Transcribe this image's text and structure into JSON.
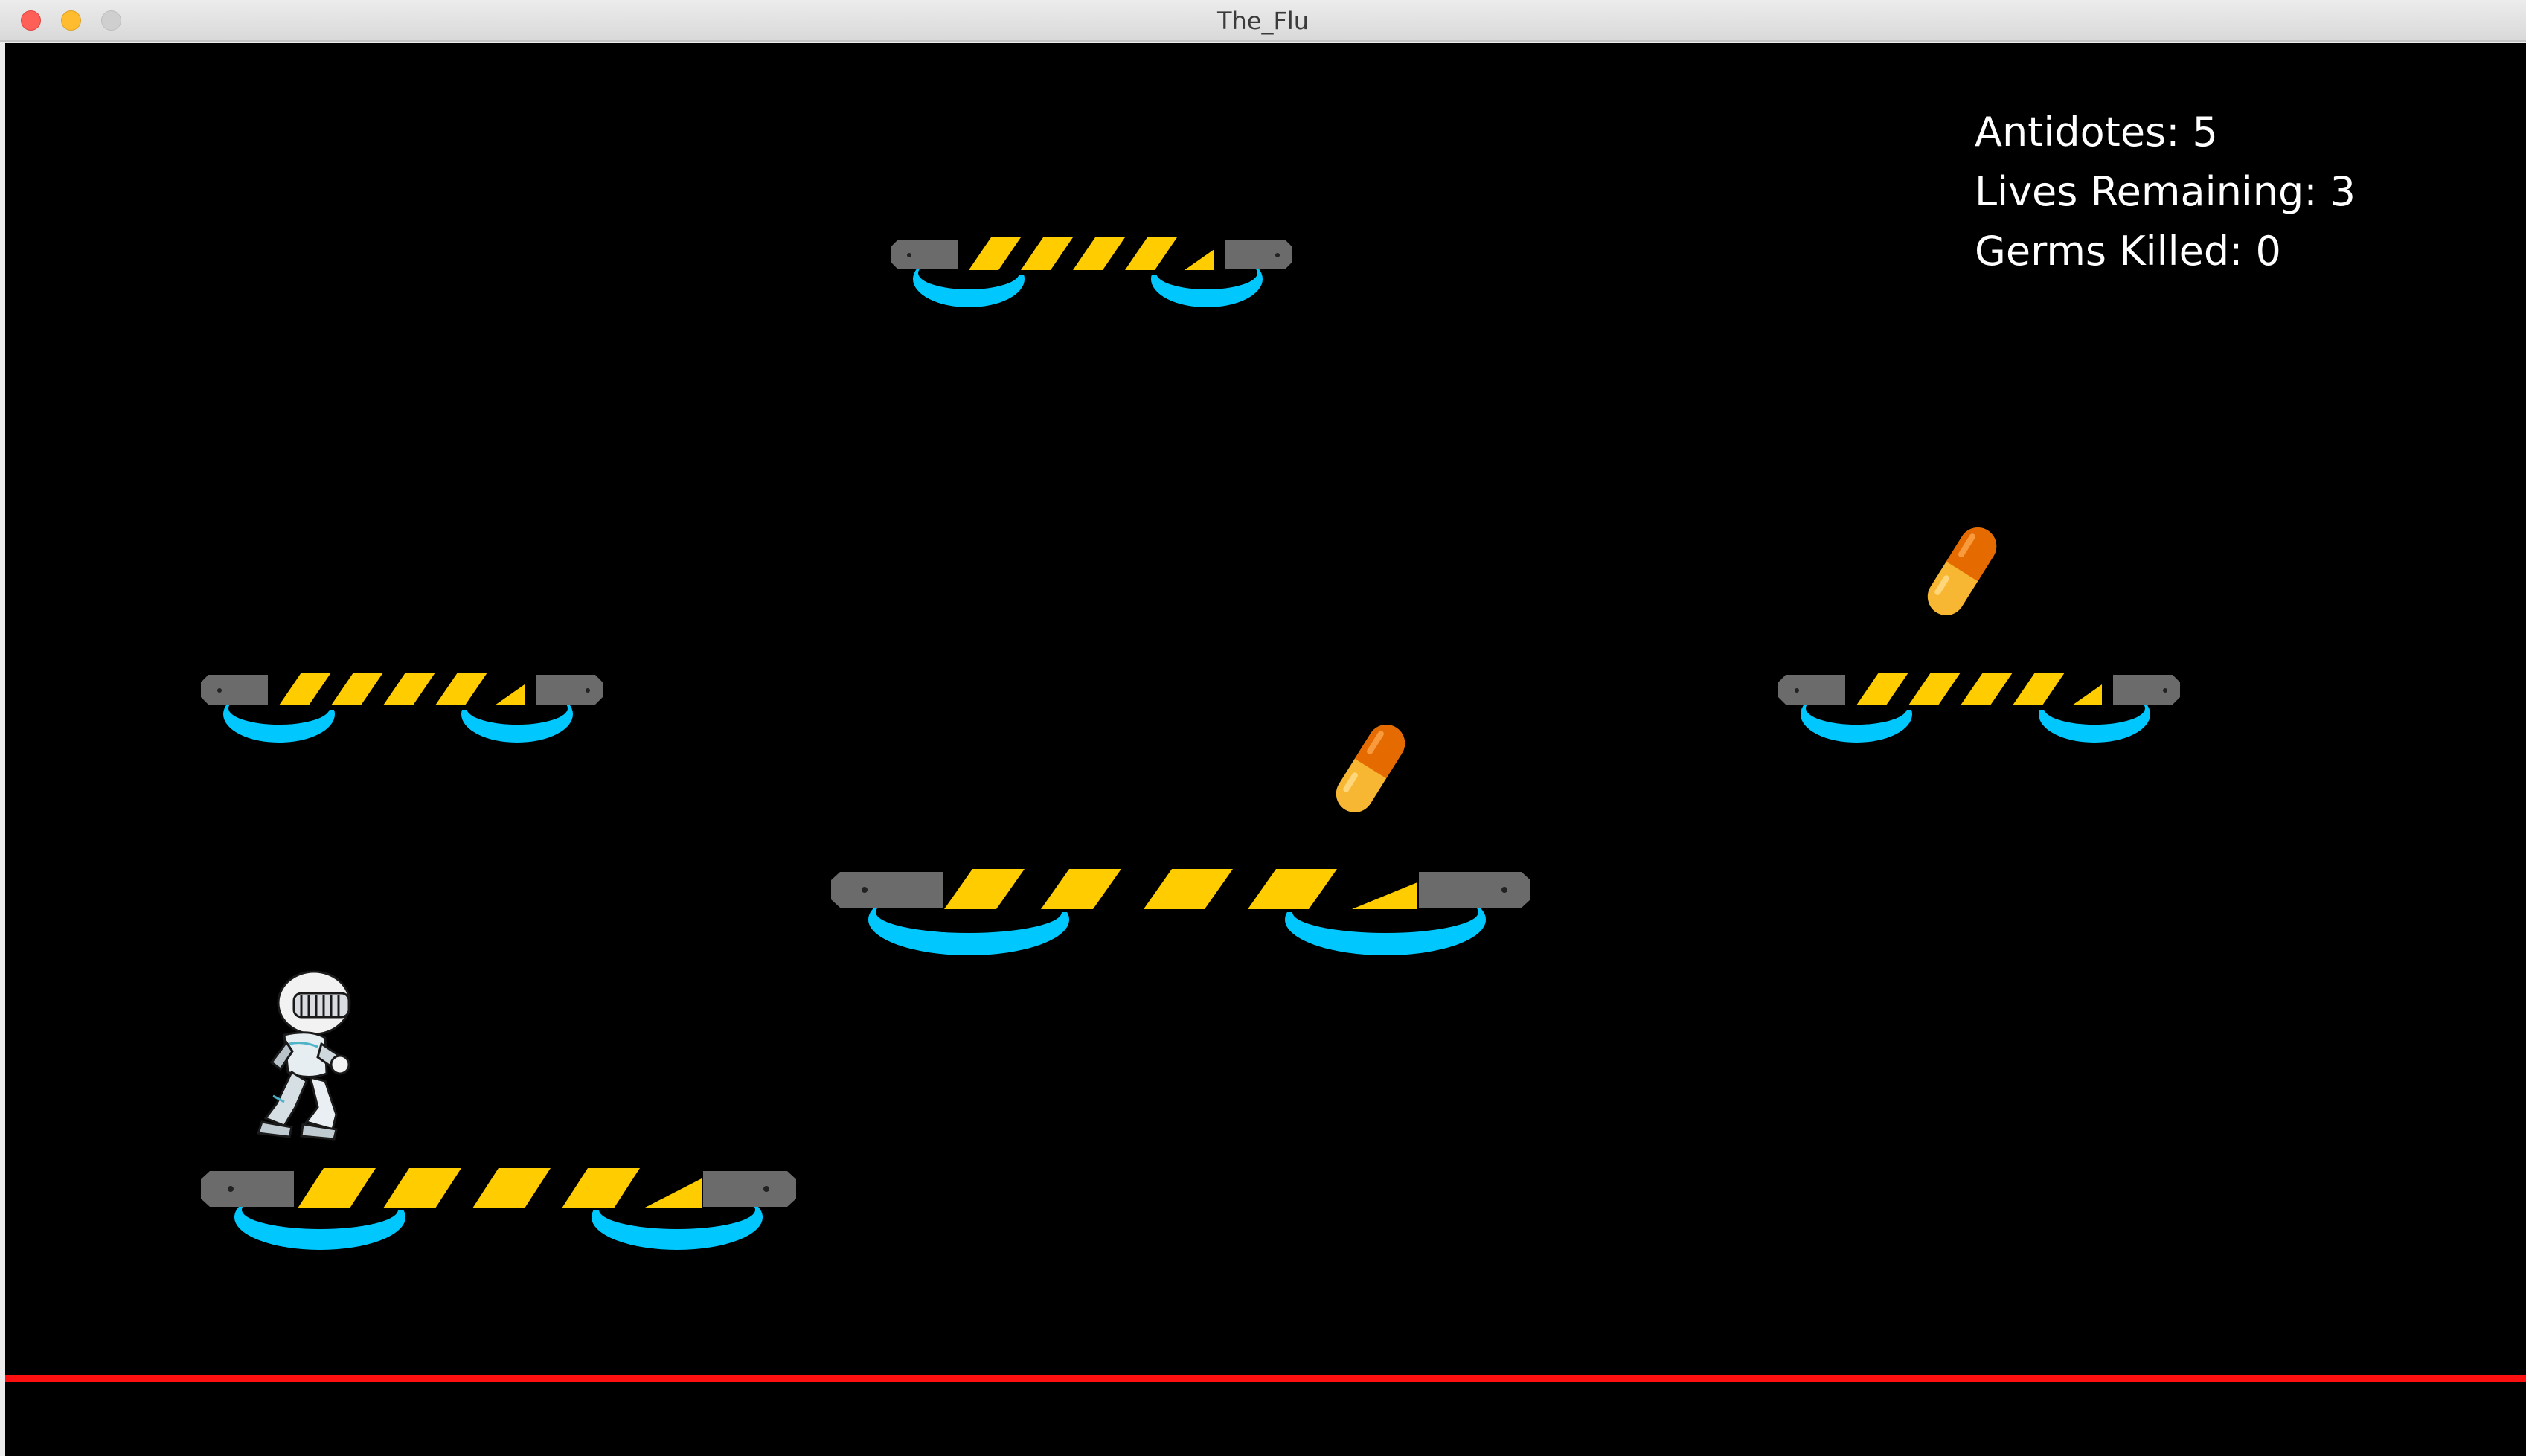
{
  "window": {
    "title": "The_Flu",
    "controls": {
      "close_icon": "close-icon",
      "minimize_icon": "minimize-icon",
      "zoom_icon": "zoom-icon"
    }
  },
  "hud": {
    "antidotes": {
      "label": "Antidotes",
      "value": "5"
    },
    "lives": {
      "label": "Lives Remaining",
      "value": "3"
    },
    "germs": {
      "label": "Germs Killed",
      "value": "0"
    }
  },
  "scene": {
    "platform_icon": "hover-platform",
    "pill_icon": "antidote-pill",
    "player_icon": "knight-player",
    "hazard_line_color": "#ff1010",
    "platform_colors": {
      "stripe_yellow": "#ffcc00",
      "metal_gray": "#6b6b6b",
      "thruster_blue": "#00c8ff"
    },
    "pill_colors": {
      "cap": "#e56a00",
      "body": "#f7b733"
    }
  }
}
